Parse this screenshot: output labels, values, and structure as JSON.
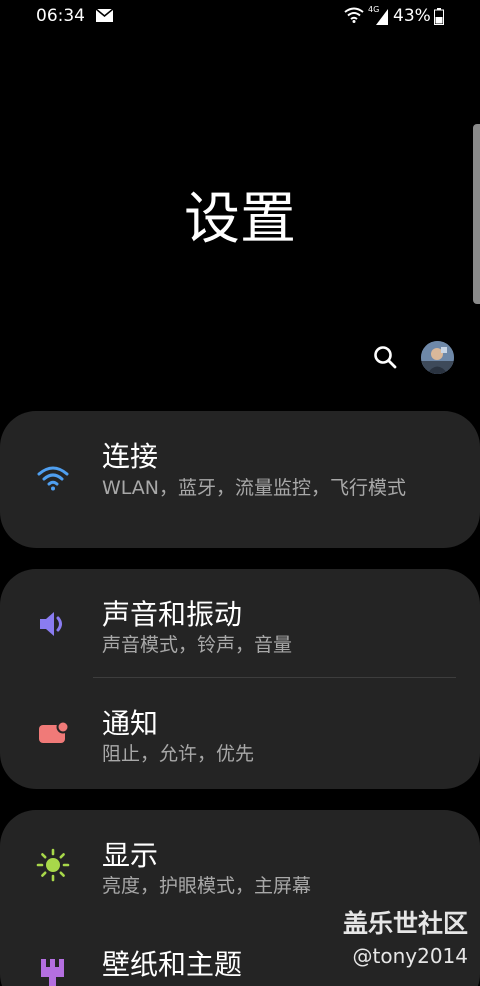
{
  "status_bar": {
    "time": "06:34",
    "network_type": "4G",
    "battery_percent": "43%"
  },
  "header": {
    "title": "设置"
  },
  "settings": {
    "connections": {
      "title": "连接",
      "subtitle": "WLAN，蓝牙，流量监控，飞行模式",
      "icon": "wifi-icon",
      "icon_color": "#4f9ff0"
    },
    "sound": {
      "title": "声音和振动",
      "subtitle": "声音模式，铃声，音量",
      "icon": "speaker-icon",
      "icon_color": "#8a7cf0"
    },
    "notifications": {
      "title": "通知",
      "subtitle": "阻止，允许，优先",
      "icon": "notification-icon",
      "icon_color": "#f07a78"
    },
    "display": {
      "title": "显示",
      "subtitle": "亮度，护眼模式，主屏幕",
      "icon": "brightness-icon",
      "icon_color": "#a8d84a"
    },
    "wallpaper": {
      "title": "壁纸和主题",
      "icon": "paintbrush-icon",
      "icon_color": "#b46fe0"
    }
  },
  "watermark": {
    "title": "盖乐世社区",
    "user": "@tony2014"
  }
}
